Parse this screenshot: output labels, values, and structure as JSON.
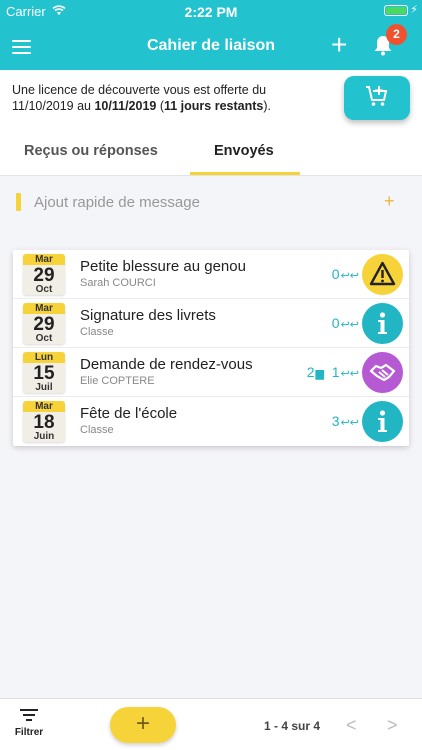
{
  "status": {
    "carrier": "Carrier",
    "time": "2:22 PM"
  },
  "header": {
    "title": "Cahier de liaison",
    "notification_count": "2"
  },
  "licence": {
    "part1": "Une licence de découverte vous est offerte du 11/10/2019 au ",
    "end_date": "10/11/2019",
    "part2": " (",
    "remaining": "11 jours restants",
    "part3": ")."
  },
  "tabs": [
    {
      "label": "Reçus ou réponses"
    },
    {
      "label": "Envoyés"
    }
  ],
  "quick_message": {
    "placeholder": "Ajout rapide de message",
    "add": "+"
  },
  "messages": [
    {
      "month": "Mar",
      "day": "29",
      "sub": "Oct",
      "title": "Petite blessure au genou",
      "author": "Sarah COURCI",
      "comments": "",
      "replies": "0",
      "type": "warning-icon",
      "color": "#f7d33a"
    },
    {
      "month": "Mar",
      "day": "29",
      "sub": "Oct",
      "title": "Signature des livrets",
      "author": "Classe",
      "comments": "",
      "replies": "0",
      "type": "info-icon",
      "color": "#22b6c4"
    },
    {
      "month": "Lun",
      "day": "15",
      "sub": "Juil",
      "title": "Demande de rendez-vous",
      "author": "Elie COPTERE",
      "comments": "2",
      "replies": "1",
      "type": "handshake-icon",
      "color": "#b55ad3"
    },
    {
      "month": "Mar",
      "day": "18",
      "sub": "Juin",
      "title": "Fête de l'école",
      "author": "Classe",
      "comments": "",
      "replies": "3",
      "type": "info-icon",
      "color": "#22b6c4"
    }
  ],
  "footer": {
    "filter_label": "Filtrer",
    "fab": "+",
    "pager": "1 - 4 sur 4"
  }
}
